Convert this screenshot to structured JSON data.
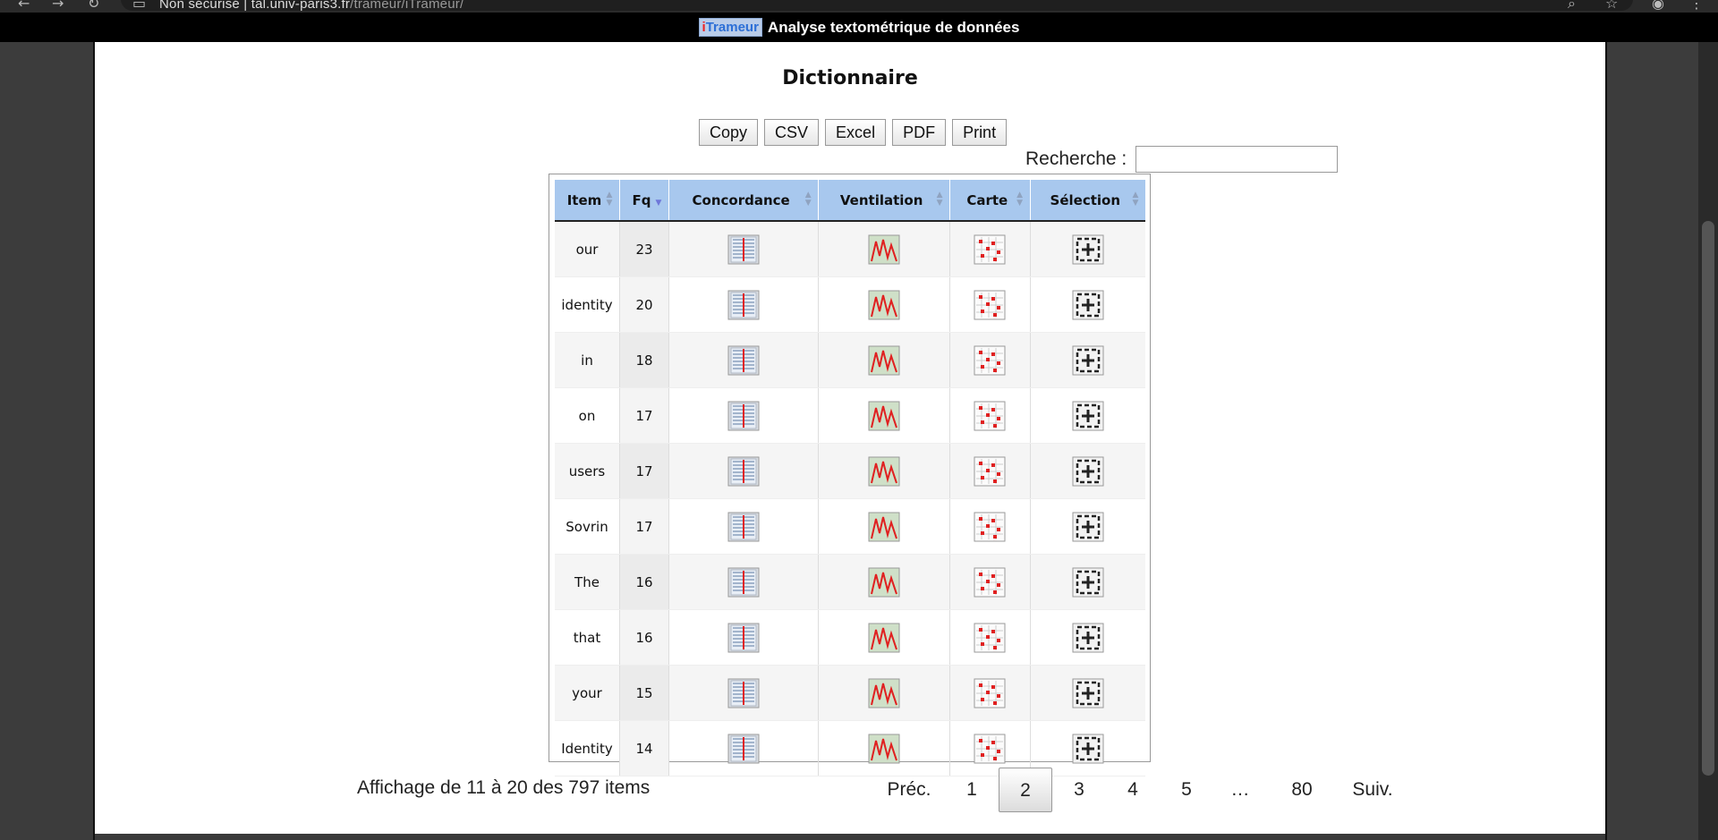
{
  "browser": {
    "url_host": "Non sécurisé | tal.univ-paris3.fr",
    "url_path": "/trameur/iTrameur/"
  },
  "header": {
    "logo_text": "iTrameur",
    "tagline": "Analyse textométrique de données"
  },
  "page": {
    "title": "Dictionnaire",
    "export_buttons": [
      "Copy",
      "CSV",
      "Excel",
      "PDF",
      "Print"
    ],
    "search": {
      "label": "Recherche :",
      "value": ""
    }
  },
  "table": {
    "columns": [
      "Item",
      "Fq",
      "Concordance",
      "Ventilation",
      "Carte",
      "Sélection"
    ],
    "sorted_column": "Fq",
    "sort_direction": "descending",
    "rows": [
      {
        "item": "our",
        "fq": "23"
      },
      {
        "item": "identity",
        "fq": "20"
      },
      {
        "item": "in",
        "fq": "18"
      },
      {
        "item": "on",
        "fq": "17"
      },
      {
        "item": "users",
        "fq": "17"
      },
      {
        "item": "Sovrin",
        "fq": "17"
      },
      {
        "item": "The",
        "fq": "16"
      },
      {
        "item": "that",
        "fq": "16"
      },
      {
        "item": "your",
        "fq": "15"
      },
      {
        "item": "Identity",
        "fq": "14"
      }
    ],
    "icons": {
      "concordance": "concordance-list-icon",
      "ventilation": "distribution-graph-icon",
      "carte": "map-grid-icon",
      "selection": "add-selection-icon"
    }
  },
  "footer": {
    "info": "Affichage de 11 à 20 des 797 items",
    "pagination": {
      "prev": "Préc.",
      "pages": [
        "1",
        "2",
        "3",
        "4",
        "5",
        "…",
        "80"
      ],
      "current": "2",
      "next": "Suiv."
    }
  },
  "colors": {
    "header_bg": "#000000",
    "table_header": "#a8c8ee",
    "page_bg": "#ffffff"
  }
}
